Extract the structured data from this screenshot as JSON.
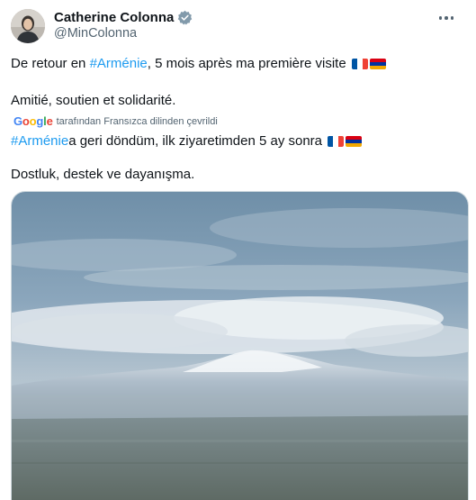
{
  "author": {
    "display_name": "Catherine Colonna",
    "handle": "@MinColonna",
    "verified_icon": "verified-badge-icon",
    "avatar_icon": "profile-avatar"
  },
  "menu": {
    "icon": "more-options-icon"
  },
  "original": {
    "line1_prefix": "De retour en",
    "line1_hashtag": "#Arménie",
    "line1_suffix": ", 5 mois après ma première visite",
    "line2": "Amitié, soutien et solidarité."
  },
  "translation_label": {
    "provider": "Google",
    "text": "tarafından Fransızca dilinden çevrildi"
  },
  "translated": {
    "line1_hashtag": "#Arménie",
    "line1_suffix": " a geri döndüm, ilk ziyaretimden 5 ay sonra",
    "line2": "Dostluk, destek ve dayanışma."
  },
  "flags": [
    "flag-france-icon",
    "flag-armenia-icon"
  ],
  "colors": {
    "link": "#1d9bf0",
    "secondary_text": "#536471",
    "verified_badge": "#829aab"
  },
  "media": {
    "alt": ""
  }
}
